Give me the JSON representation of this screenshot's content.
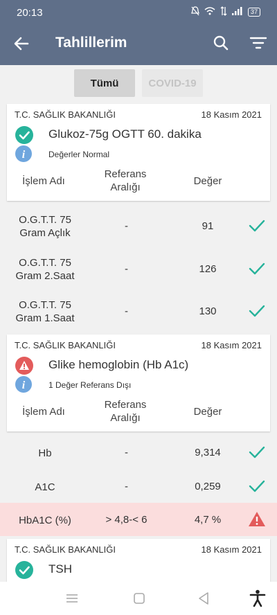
{
  "status_bar": {
    "time": "20:13",
    "battery": "37"
  },
  "app_bar": {
    "title": "Tahlillerim"
  },
  "tabs": [
    {
      "label": "Tümü"
    },
    {
      "label": "COVID-19"
    }
  ],
  "headers": {
    "name": "İşlem Adı",
    "ref_line1": "Referans",
    "ref_line2": "Aralığı",
    "value": "Değer"
  },
  "cards": [
    {
      "org": "T.C. SAĞLIK BAKANLIĞI",
      "date": "18 Kasım 2021",
      "title": "Glukoz-75g OGTT 60. dakika",
      "status": "Değerler Normal",
      "rows": [
        {
          "name1": "O.G.T.T. 75",
          "name2": "Gram Açlık",
          "ref": "-",
          "value": "91"
        },
        {
          "name1": "O.G.T.T. 75",
          "name2": "Gram 2.Saat",
          "ref": "-",
          "value": "126"
        },
        {
          "name1": "O.G.T.T. 75",
          "name2": "Gram 1.Saat",
          "ref": "-",
          "value": "130"
        }
      ]
    },
    {
      "org": "T.C. SAĞLIK BAKANLIĞI",
      "date": "18 Kasım 2021",
      "title": "Glike hemoglobin (Hb A1c)",
      "status": "1 Değer Referans Dışı",
      "rows": [
        {
          "name": "Hb",
          "ref": "-",
          "value": "9,314"
        },
        {
          "name": "A1C",
          "ref": "-",
          "value": "0,259"
        },
        {
          "name": "HbA1C (%)",
          "ref": "> 4,8-< 6",
          "value": "4,7 %"
        }
      ]
    },
    {
      "org": "T.C. SAĞLIK BAKANLIĞI",
      "date": "18 Kasım 2021",
      "title": "TSH"
    }
  ],
  "colors": {
    "header": "#5f6f89",
    "ok": "#27b39b",
    "alert": "#e35b5b",
    "alert_row": "#fbdddd",
    "info": "#6fa6de"
  }
}
